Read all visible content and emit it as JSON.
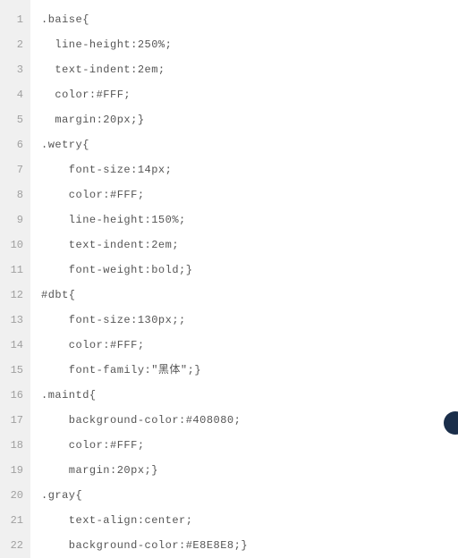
{
  "lines": [
    {
      "num": "1",
      "indent": 0,
      "text": ".baise{"
    },
    {
      "num": "2",
      "indent": 1,
      "text": "line-height:250%;"
    },
    {
      "num": "3",
      "indent": 1,
      "text": "text-indent:2em;"
    },
    {
      "num": "4",
      "indent": 1,
      "text": "color:#FFF;"
    },
    {
      "num": "5",
      "indent": 1,
      "text": "margin:20px;}"
    },
    {
      "num": "6",
      "indent": 0,
      "text": ".wetry{"
    },
    {
      "num": "7",
      "indent": 2,
      "text": "font-size:14px;"
    },
    {
      "num": "8",
      "indent": 2,
      "text": "color:#FFF;"
    },
    {
      "num": "9",
      "indent": 2,
      "text": "line-height:150%;"
    },
    {
      "num": "10",
      "indent": 2,
      "text": "text-indent:2em;"
    },
    {
      "num": "11",
      "indent": 2,
      "text": "font-weight:bold;}"
    },
    {
      "num": "12",
      "indent": 0,
      "text": "#dbt{"
    },
    {
      "num": "13",
      "indent": 2,
      "text": "font-size:130px;;"
    },
    {
      "num": "14",
      "indent": 2,
      "text": "color:#FFF;"
    },
    {
      "num": "15",
      "indent": 2,
      "text": "font-family:\"黑体\";}"
    },
    {
      "num": "16",
      "indent": 0,
      "text": ".maintd{"
    },
    {
      "num": "17",
      "indent": 2,
      "text": "background-color:#408080;"
    },
    {
      "num": "18",
      "indent": 2,
      "text": "color:#FFF;"
    },
    {
      "num": "19",
      "indent": 2,
      "text": "margin:20px;}"
    },
    {
      "num": "20",
      "indent": 0,
      "text": ".gray{"
    },
    {
      "num": "21",
      "indent": 2,
      "text": "text-align:center;"
    },
    {
      "num": "22",
      "indent": 2,
      "text": "background-color:#E8E8E8;}"
    }
  ]
}
